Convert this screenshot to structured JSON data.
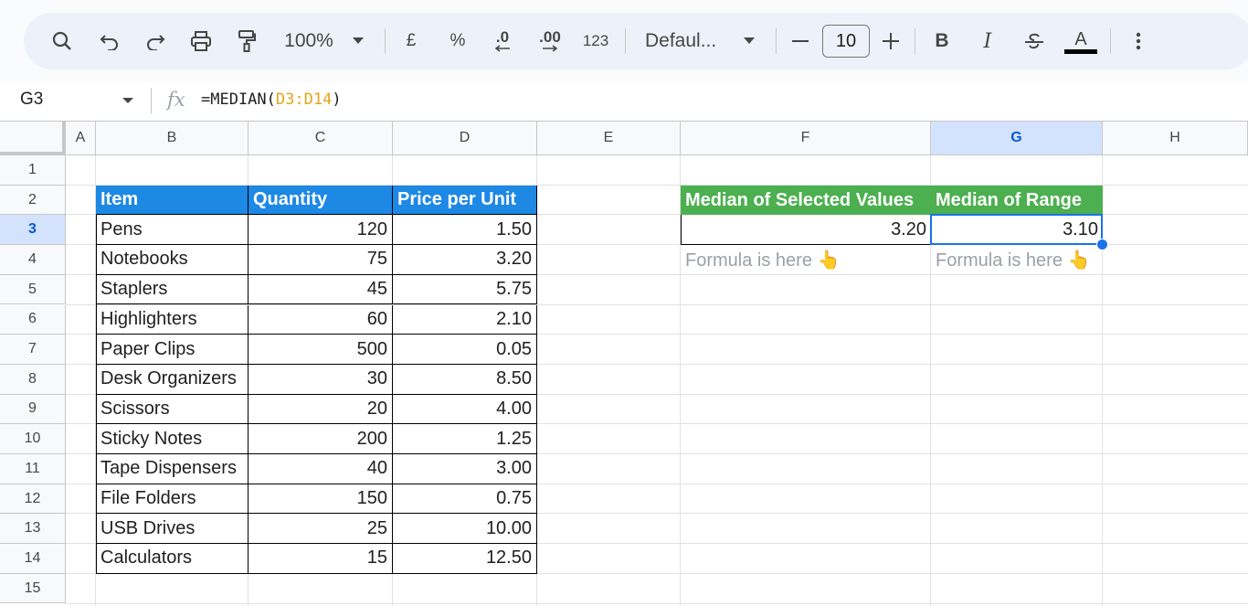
{
  "toolbar": {
    "zoom": "100%",
    "currency": "£",
    "percent": "%",
    "decrease_decimal": ".0",
    "increase_decimal": ".00",
    "more_formats": "123",
    "font": "Defaul...",
    "font_size": "10",
    "bold": "B",
    "italic": "I",
    "text_color": "A"
  },
  "formula_bar": {
    "name_box": "G3",
    "fx": "fx",
    "formula_prefix": "=MEDIAN(",
    "formula_ref": "D3:D14",
    "formula_suffix": ")"
  },
  "columns": [
    "A",
    "B",
    "C",
    "D",
    "E",
    "F",
    "G",
    "H"
  ],
  "rows": [
    "1",
    "2",
    "3",
    "4",
    "5",
    "6",
    "7",
    "8",
    "9",
    "10",
    "11",
    "12",
    "13",
    "14",
    "15"
  ],
  "selected_cell": {
    "column": "G",
    "row": "3"
  },
  "table": {
    "headers": [
      "Item",
      "Quantity",
      "Price per Unit"
    ],
    "rows": [
      [
        "Pens",
        "120",
        "1.50"
      ],
      [
        "Notebooks",
        "75",
        "3.20"
      ],
      [
        "Staplers",
        "45",
        "5.75"
      ],
      [
        "Highlighters",
        "60",
        "2.10"
      ],
      [
        "Paper Clips",
        "500",
        "0.05"
      ],
      [
        "Desk Organizers",
        "30",
        "8.50"
      ],
      [
        "Scissors",
        "20",
        "4.00"
      ],
      [
        "Sticky Notes",
        "200",
        "1.25"
      ],
      [
        "Tape Dispensers",
        "40",
        "3.00"
      ],
      [
        "File Folders",
        "150",
        "0.75"
      ],
      [
        "USB Drives",
        "25",
        "10.00"
      ],
      [
        "Calculators",
        "15",
        "12.50"
      ]
    ]
  },
  "results": {
    "headers": [
      "Median of Selected Values",
      "Median of Range"
    ],
    "values": [
      "3.20",
      "3.10"
    ],
    "hints": [
      "Formula is here 👆",
      "Formula is here 👆"
    ]
  },
  "colors": {
    "table_header": "#1e88e5",
    "result_header": "#4caf50",
    "selection": "#1a73e8",
    "formula_ref": "#e8a317"
  }
}
